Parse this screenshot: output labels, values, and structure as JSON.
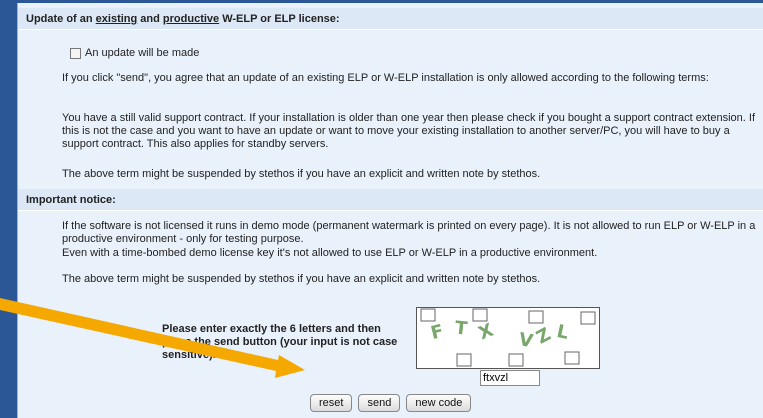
{
  "section1": {
    "title_prefix": "Update of an ",
    "title_word1": "existing",
    "title_mid": " and ",
    "title_word2": "productive",
    "title_suffix": " W-ELP or ELP license:"
  },
  "update_checkbox": {
    "label": "An update will be made",
    "checked": false
  },
  "para_send_terms": "If you click \"send\", you agree that an update of an existing ELP or W-ELP installation is only allowed according to the following terms:",
  "para_support": "You have a still valid support contract. If your installation is older than one year then please check if you bought a support contract extension. If this is not the case and you want to have an update or want to move your existing installation to another server/PC, you will have to buy a support contract. This also applies for standby servers.",
  "para_suspend_1": "The above term might be suspended by stethos if you have an explicit and written note by stethos.",
  "section2": {
    "title": "Important notice:"
  },
  "para_demo_1": "If the software is not licensed it runs in demo mode (permanent watermark is printed on every page). It is not allowed to run ELP or W-ELP in a productive environment - only for testing purpose.",
  "para_demo_2": "Even with a time-bombed demo license key it's not allowed to use ELP or W-ELP in a productive environment.",
  "para_suspend_2": "The above term might be suspended by stethos if you have an explicit and written note by stethos.",
  "captcha": {
    "instruction": "Please enter exactly the 6 letters and then press the send button (your input is not case sensitive).",
    "image_letters": [
      "F",
      "T",
      "X",
      "V",
      "Z",
      "L"
    ],
    "input_value": "ftxvzl"
  },
  "buttons": {
    "reset": "reset",
    "send": "send",
    "new_code": "new code"
  },
  "colors": {
    "background": "#2b5797",
    "panel": "#e9f1fb",
    "arrow": "#f5a800",
    "captcha_letters": "#79a66a"
  }
}
